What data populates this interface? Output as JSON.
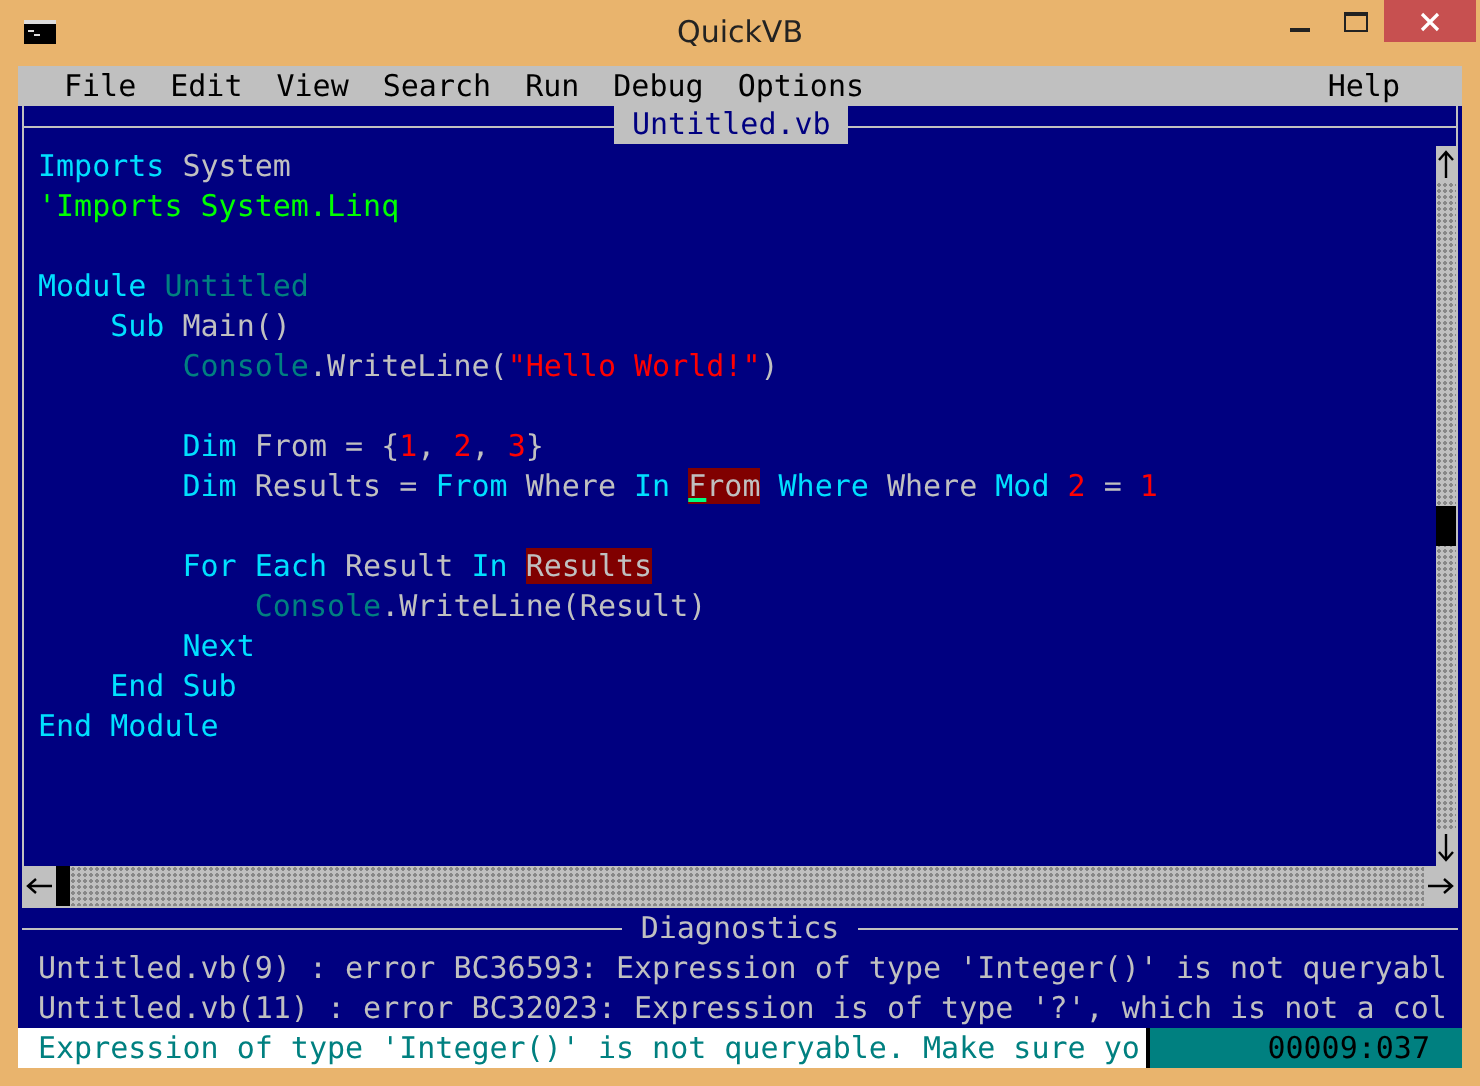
{
  "window": {
    "title": "QuickVB"
  },
  "menu": [
    {
      "label": "File"
    },
    {
      "label": "Edit"
    },
    {
      "label": "View"
    },
    {
      "label": "Search"
    },
    {
      "label": "Run"
    },
    {
      "label": "Debug"
    },
    {
      "label": "Options"
    },
    {
      "label": "Help"
    }
  ],
  "editor": {
    "tab": "Untitled.vb",
    "lines": [
      {
        "kind": "code",
        "tokens": [
          {
            "text": "Imports",
            "kind": "keyword"
          },
          {
            "text": " System",
            "kind": "plain"
          }
        ]
      },
      {
        "kind": "code",
        "tokens": [
          {
            "text": "'Imports System.Linq",
            "kind": "comment"
          }
        ]
      },
      {
        "kind": "blank"
      },
      {
        "kind": "code",
        "tokens": [
          {
            "text": "Module",
            "kind": "keyword"
          },
          {
            "text": " Untitled",
            "kind": "type"
          }
        ]
      },
      {
        "kind": "code",
        "tokens": [
          {
            "text": "    Sub",
            "kind": "keyword"
          },
          {
            "text": " Main()",
            "kind": "plain"
          }
        ]
      },
      {
        "kind": "code",
        "tokens": [
          {
            "text": "        Console",
            "kind": "type"
          },
          {
            "text": ".WriteLine(",
            "kind": "plain"
          },
          {
            "text": "\"Hello World!\"",
            "kind": "string"
          },
          {
            "text": ")",
            "kind": "plain"
          }
        ]
      },
      {
        "kind": "blank"
      },
      {
        "kind": "code",
        "tokens": [
          {
            "text": "        Dim",
            "kind": "keyword"
          },
          {
            "text": " From = {",
            "kind": "plain"
          },
          {
            "text": "1",
            "kind": "number"
          },
          {
            "text": ", ",
            "kind": "plain"
          },
          {
            "text": "2",
            "kind": "number"
          },
          {
            "text": ", ",
            "kind": "plain"
          },
          {
            "text": "3",
            "kind": "number"
          },
          {
            "text": "}",
            "kind": "plain"
          }
        ]
      },
      {
        "kind": "code",
        "tokens": [
          {
            "text": "        Dim",
            "kind": "keyword"
          },
          {
            "text": " Results = ",
            "kind": "plain"
          },
          {
            "text": "From",
            "kind": "keyword"
          },
          {
            "text": " Where ",
            "kind": "plain"
          },
          {
            "text": "In ",
            "kind": "keyword"
          },
          {
            "text": "From",
            "kind": "error",
            "cursor": true
          },
          {
            "text": " Where",
            "kind": "keyword"
          },
          {
            "text": " Where ",
            "kind": "plain"
          },
          {
            "text": "Mod ",
            "kind": "keyword"
          },
          {
            "text": "2",
            "kind": "number"
          },
          {
            "text": " = ",
            "kind": "plain"
          },
          {
            "text": "1",
            "kind": "number"
          }
        ]
      },
      {
        "kind": "blank"
      },
      {
        "kind": "code",
        "tokens": [
          {
            "text": "        For Each",
            "kind": "keyword"
          },
          {
            "text": " Result ",
            "kind": "plain"
          },
          {
            "text": "In ",
            "kind": "keyword"
          },
          {
            "text": "Results",
            "kind": "error"
          }
        ]
      },
      {
        "kind": "code",
        "tokens": [
          {
            "text": "            Console",
            "kind": "type"
          },
          {
            "text": ".WriteLine(Result)",
            "kind": "plain"
          }
        ]
      },
      {
        "kind": "code",
        "tokens": [
          {
            "text": "        Next",
            "kind": "keyword"
          }
        ]
      },
      {
        "kind": "code",
        "tokens": [
          {
            "text": "    End Sub",
            "kind": "keyword"
          }
        ]
      },
      {
        "kind": "code",
        "tokens": [
          {
            "text": "End Module",
            "kind": "keyword"
          }
        ]
      }
    ]
  },
  "diagnostics": {
    "title": "Diagnostics",
    "items": [
      "Untitled.vb(9) : error BC36593: Expression of type 'Integer()' is not queryabl",
      "Untitled.vb(11) : error BC32023: Expression is of type '?', which is not a col"
    ]
  },
  "status_bar": {
    "message": "Expression of type 'Integer()' is not queryable. Make sure yo",
    "position": "00009:037"
  }
}
